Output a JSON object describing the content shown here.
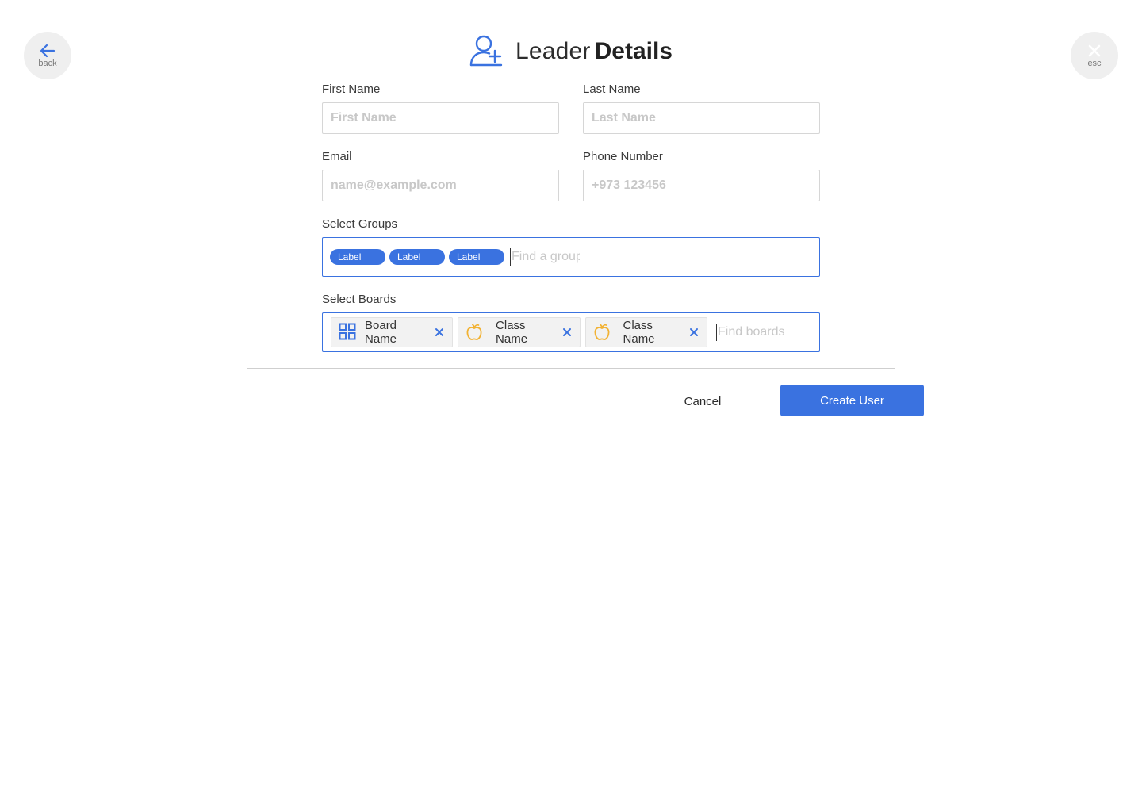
{
  "nav": {
    "back_label": "back",
    "esc_label": "esc"
  },
  "header": {
    "title_light": "Leader",
    "title_bold": "Details",
    "icon": "add-user-icon"
  },
  "form": {
    "first_name": {
      "label": "First Name",
      "placeholder": "First Name",
      "value": ""
    },
    "last_name": {
      "label": "Last Name",
      "placeholder": "Last Name",
      "value": ""
    },
    "email": {
      "label": "Email",
      "placeholder": "name@example.com",
      "value": ""
    },
    "phone": {
      "label": "Phone Number",
      "placeholder": "+973 123456",
      "value": ""
    },
    "groups": {
      "label": "Select Groups",
      "selected": [
        "Label",
        "Label",
        "Label"
      ],
      "placeholder": "Find a group"
    },
    "boards": {
      "label": "Select Boards",
      "selected": [
        {
          "name": "Board Name",
          "icon": "grid-icon"
        },
        {
          "name": "Class Name",
          "icon": "apple-icon"
        },
        {
          "name": "Class Name",
          "icon": "apple-icon"
        }
      ],
      "placeholder": "Find boards"
    }
  },
  "actions": {
    "cancel_label": "Cancel",
    "create_label": "Create User"
  },
  "colors": {
    "accent": "#3a72e0",
    "apple": "#f2b233"
  }
}
